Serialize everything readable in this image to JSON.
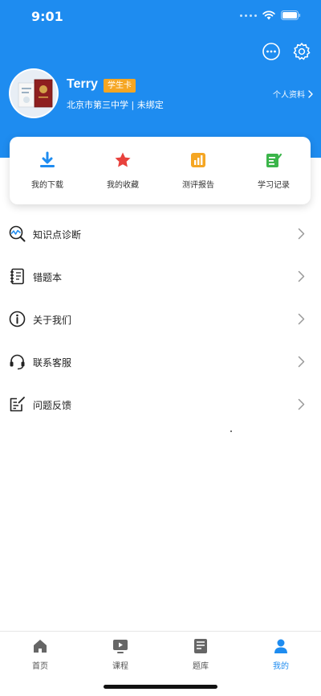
{
  "status_bar": {
    "time": "9:01"
  },
  "header": {
    "user_name": "Terry",
    "badge": "学生卡",
    "school_line": "北京市第三中学 | 未绑定",
    "profile_link": "个人资料"
  },
  "quick_actions": [
    {
      "label": "我的下载",
      "icon": "download-icon"
    },
    {
      "label": "我的收藏",
      "icon": "star-icon"
    },
    {
      "label": "测评报告",
      "icon": "report-icon"
    },
    {
      "label": "学习记录",
      "icon": "record-icon"
    }
  ],
  "menu": [
    {
      "label": "知识点诊断",
      "icon": "diagnosis-icon"
    },
    {
      "label": "错题本",
      "icon": "notebook-icon"
    },
    {
      "label": "关于我们",
      "icon": "info-icon"
    },
    {
      "label": "联系客服",
      "icon": "headset-icon"
    },
    {
      "label": "问题反馈",
      "icon": "feedback-icon"
    }
  ],
  "tabs": [
    {
      "label": "首页",
      "icon": "home-icon"
    },
    {
      "label": "课程",
      "icon": "play-icon"
    },
    {
      "label": "题库",
      "icon": "question-bank-icon"
    },
    {
      "label": "我的",
      "icon": "profile-icon",
      "active": true
    }
  ],
  "colors": {
    "primary": "#1e8cf0",
    "badge": "#f5a623",
    "download": "#1e8cf0",
    "star": "#e8413c",
    "report": "#f5a623",
    "record": "#3bb54a"
  }
}
